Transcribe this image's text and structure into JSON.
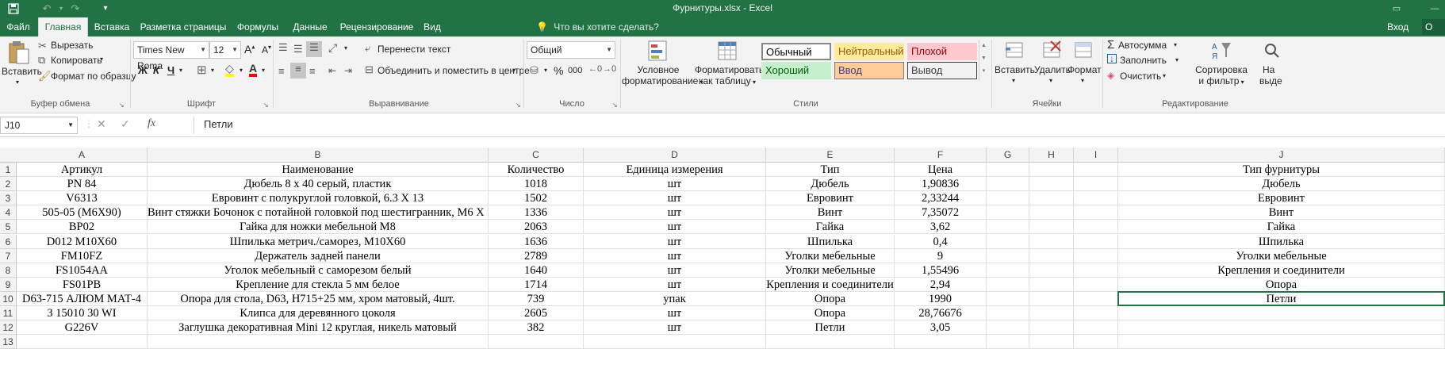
{
  "window": {
    "title": "Фурнитуры.xlsx - Excel"
  },
  "tabs": [
    "Файл",
    "Главная",
    "Вставка",
    "Разметка страницы",
    "Формулы",
    "Данные",
    "Рецензирование",
    "Вид"
  ],
  "tell_me": "Что вы хотите сделать?",
  "signin": "Вход",
  "share": "О",
  "ribbon": {
    "clipboard": {
      "paste": "Вставить",
      "cut": "Вырезать",
      "copy": "Копировать",
      "format_painter": "Формат по образцу",
      "label": "Буфер обмена"
    },
    "font": {
      "font_name": "Times New Roma",
      "font_size": "12",
      "bold": "Ж",
      "italic": "К",
      "underline": "Ч",
      "label": "Шрифт"
    },
    "alignment": {
      "wrap": "Перенести текст",
      "merge": "Объединить и поместить в центре",
      "label": "Выравнивание"
    },
    "number": {
      "format": "Общий",
      "percent": "%",
      "thousands": "000",
      "label": "Число"
    },
    "styles": {
      "conditional_line1": "Условное",
      "conditional_line2": "форматирование",
      "table_line1": "Форматировать",
      "table_line2": "как таблицу",
      "cells": [
        {
          "label": "Обычный",
          "bg": "#ffffff",
          "fg": "#000000",
          "border": "#a6a6a6"
        },
        {
          "label": "Нейтральный",
          "bg": "#ffeb9c",
          "fg": "#9c5700",
          "border": "#ffeb9c"
        },
        {
          "label": "Плохой",
          "bg": "#ffc7ce",
          "fg": "#9c0006",
          "border": "#ffc7ce"
        },
        {
          "label": "Хороший",
          "bg": "#c6efce",
          "fg": "#006100",
          "border": "#c6efce"
        },
        {
          "label": "Ввод",
          "bg": "#ffcc99",
          "fg": "#3f3f76",
          "border": "#7f7f7f"
        },
        {
          "label": "Вывод",
          "bg": "#f2f2f2",
          "fg": "#3f3f3f",
          "border": "#3f3f3f"
        }
      ],
      "label": "Стили"
    },
    "cells": {
      "insert": "Вставить",
      "delete": "Удалить",
      "format": "Формат",
      "label": "Ячейки"
    },
    "editing": {
      "autosum": "Автосумма",
      "fill": "Заполнить",
      "clear": "Очистить",
      "sort_line1": "Сортировка",
      "sort_line2": "и фильтр",
      "find_line1": "На",
      "find_line2": "выде",
      "label": "Редактирование"
    }
  },
  "formula_bar": {
    "name_box": "J10",
    "fx": "fx",
    "content": "Петли"
  },
  "sheet": {
    "columns": [
      "A",
      "B",
      "C",
      "D",
      "E",
      "F",
      "G",
      "H",
      "I",
      "J"
    ],
    "row_numbers": [
      "1",
      "2",
      "3",
      "4",
      "5",
      "6",
      "7",
      "8",
      "9",
      "10",
      "11",
      "12",
      "13"
    ],
    "rows": [
      [
        "Артикул",
        "Наименование",
        "Количество",
        "Единица измерения",
        "Тип",
        "Цена",
        "",
        "",
        "",
        "Тип фурнитуры"
      ],
      [
        "PN 84",
        "Дюбель 8 х 40 серый, пластик",
        "1018",
        "шт",
        "Дюбель",
        "1,90836",
        "",
        "",
        "",
        "Дюбель"
      ],
      [
        "V6313",
        "Евровинт с полукруглой головкой, 6.3 X 13",
        "1502",
        "шт",
        "Евровинт",
        "2,33244",
        "",
        "",
        "",
        "Евровинт"
      ],
      [
        "505-05 (M6X90)",
        "Винт стяжки Бочонок с потайной головкой под шестигранник, M6 X 90",
        "1336",
        "шт",
        "Винт",
        "7,35072",
        "",
        "",
        "",
        "Винт"
      ],
      [
        "BP02",
        "Гайка для ножки мебельной M8",
        "2063",
        "шт",
        "Гайка",
        "3,62",
        "",
        "",
        "",
        "Гайка"
      ],
      [
        "D012 M10X60",
        "Шпилька метрич./саморез, M10X60",
        "1636",
        "шт",
        "Шпилька",
        "0,4",
        "",
        "",
        "",
        "Шпилька"
      ],
      [
        "FM10FZ",
        "Держатель задней панели",
        "2789",
        "шт",
        "Уголки мебельные",
        "9",
        "",
        "",
        "",
        "Уголки мебельные"
      ],
      [
        "FS1054AA",
        "Уголок мебельный с саморезом белый",
        "1640",
        "шт",
        "Уголки мебельные",
        "1,55496",
        "",
        "",
        "",
        "Крепления и соединители"
      ],
      [
        "FS01PB",
        "Крепление для стекла 5 мм белое",
        "1714",
        "шт",
        "Крепления и соединители",
        "2,94",
        "",
        "",
        "",
        "Опора"
      ],
      [
        "D63-715 АЛЮМ МАТ-4",
        "Опора для стола, D63, H715+25 мм, хром матовый, 4шт.",
        "739",
        "упак",
        "Опора",
        "1990",
        "",
        "",
        "",
        "Петли"
      ],
      [
        "3 15010 30 WI",
        "Клипса для деревянного цоколя",
        "2605",
        "шт",
        "Опора",
        "28,76676",
        "",
        "",
        "",
        ""
      ],
      [
        "G226V",
        "Заглушка декоративная Mini 12 круглая, никель матовый",
        "382",
        "шт",
        "Петли",
        "3,05",
        "",
        "",
        "",
        ""
      ],
      [
        "",
        "",
        "",
        "",
        "",
        "",
        "",
        "",
        "",
        ""
      ]
    ],
    "selected_cell": "J10"
  }
}
